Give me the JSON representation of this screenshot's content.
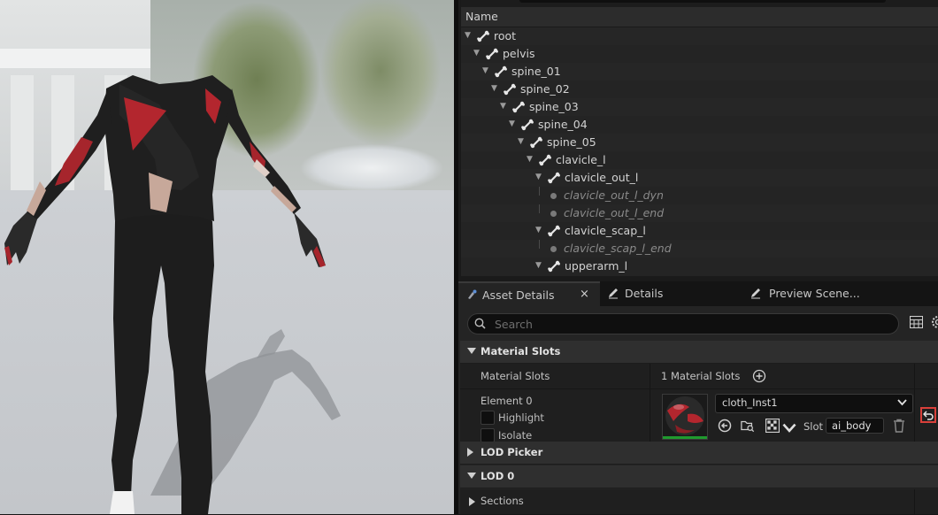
{
  "tree": {
    "column_header": "Name",
    "rows": [
      {
        "label": "root",
        "type": "bone"
      },
      {
        "label": "pelvis",
        "type": "bone"
      },
      {
        "label": "spine_01",
        "type": "bone"
      },
      {
        "label": "spine_02",
        "type": "bone"
      },
      {
        "label": "spine_03",
        "type": "bone"
      },
      {
        "label": "spine_04",
        "type": "bone"
      },
      {
        "label": "spine_05",
        "type": "bone"
      },
      {
        "label": "clavicle_l",
        "type": "bone"
      },
      {
        "label": "clavicle_out_l",
        "type": "bone"
      },
      {
        "label": "clavicle_out_l_dyn",
        "type": "virtual"
      },
      {
        "label": "clavicle_out_l_end",
        "type": "virtual"
      },
      {
        "label": "clavicle_scap_l",
        "type": "bone"
      },
      {
        "label": "clavicle_scap_l_end",
        "type": "virtual"
      },
      {
        "label": "upperarm_l",
        "type": "bone"
      }
    ]
  },
  "tabs": [
    {
      "label": "Asset Details",
      "icon": "asset-details-icon",
      "active": true,
      "close": "×"
    },
    {
      "label": "Details",
      "icon": "pencil-icon",
      "active": false
    },
    {
      "label": "Preview Scene...",
      "icon": "pencil-icon",
      "active": false
    }
  ],
  "search": {
    "placeholder": "Search"
  },
  "material_slots": {
    "category_label": "Material Slots",
    "row_label": "Material Slots",
    "count_label": "1 Material Slots",
    "element": {
      "label": "Element 0",
      "highlight_label": "Highlight",
      "isolate_label": "Isolate",
      "material": "cloth_Inst1",
      "slot_label": "Slot",
      "slot_value": "ai_body"
    }
  },
  "lod_picker": {
    "label": "LOD Picker"
  },
  "lod0": {
    "label": "LOD 0",
    "sections_label": "Sections"
  },
  "colors": {
    "panel_bg": "#242424",
    "accent_red": "#d9403a",
    "thumb_green": "#1f9a2e"
  }
}
